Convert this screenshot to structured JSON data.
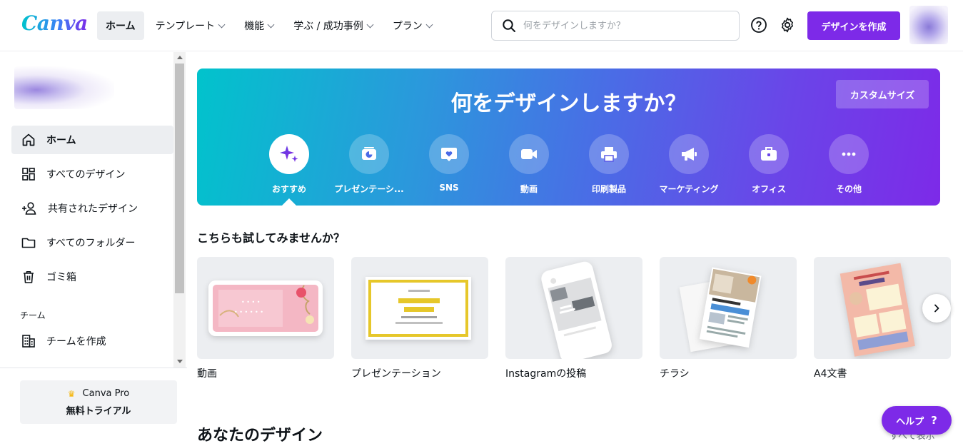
{
  "app": {
    "logo": "Canva"
  },
  "nav": {
    "items": [
      {
        "label": "ホーム",
        "active": true,
        "dropdown": false
      },
      {
        "label": "テンプレート",
        "active": false,
        "dropdown": true
      },
      {
        "label": "機能",
        "active": false,
        "dropdown": true
      },
      {
        "label": "学ぶ / 成功事例",
        "active": false,
        "dropdown": true
      },
      {
        "label": "プラン",
        "active": false,
        "dropdown": true
      }
    ],
    "search_placeholder": "何をデザインしますか？",
    "create_button": "デザインを作成"
  },
  "sidebar": {
    "items": [
      {
        "label": "ホーム",
        "icon": "home-icon",
        "active": true
      },
      {
        "label": "すべてのデザイン",
        "icon": "grid-icon",
        "active": false
      },
      {
        "label": "共有されたデザイン",
        "icon": "shared-users-icon",
        "active": false
      },
      {
        "label": "すべてのフォルダー",
        "icon": "folder-icon",
        "active": false
      },
      {
        "label": "ゴミ箱",
        "icon": "trash-icon",
        "active": false
      }
    ],
    "team_section": "チーム",
    "team_item": {
      "label": "チームを作成",
      "icon": "building-icon"
    },
    "pro": {
      "title": "Canva Pro",
      "cta": "無料トライアル"
    }
  },
  "hero": {
    "title": "何をデザインしますか？",
    "custom_size": "カスタムサイズ",
    "categories": [
      {
        "label": "おすすめ",
        "icon": "sparkle-icon",
        "selected": true
      },
      {
        "label": "プレゼンテーシ...",
        "icon": "presentation-icon",
        "selected": false
      },
      {
        "label": "SNS",
        "icon": "heart-bubble-icon",
        "selected": false
      },
      {
        "label": "動画",
        "icon": "video-camera-icon",
        "selected": false
      },
      {
        "label": "印刷製品",
        "icon": "printer-icon",
        "selected": false
      },
      {
        "label": "マーケティング",
        "icon": "megaphone-icon",
        "selected": false
      },
      {
        "label": "オフィス",
        "icon": "briefcase-icon",
        "selected": false
      },
      {
        "label": "その他",
        "icon": "more-dots-icon",
        "selected": false
      }
    ]
  },
  "suggestions": {
    "title": "こちらも試してみませんか？",
    "cards": [
      {
        "label": "動画"
      },
      {
        "label": "プレゼンテーション"
      },
      {
        "label": "Instagramの投稿"
      },
      {
        "label": "チラシ"
      },
      {
        "label": "A4文書"
      }
    ]
  },
  "your_designs": {
    "title": "あなたのデザイン",
    "see_all": "すべて表示"
  },
  "help": {
    "label": "ヘルプ",
    "mark": "?"
  },
  "colors": {
    "accent": "#7d2ae8",
    "teal": "#00c4cc"
  }
}
